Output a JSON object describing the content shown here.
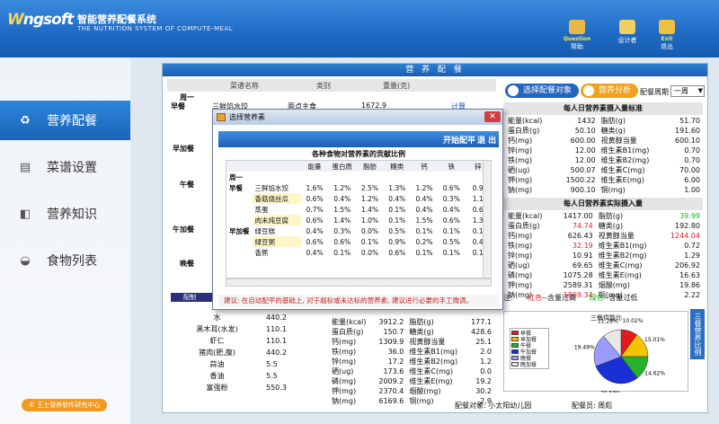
{
  "header": {
    "logo": "ngsoft",
    "title": "智能营养配餐系统",
    "subtitle": "THE NUTRITION SYSTEM OF COMPUTE-MEAL",
    "buttons": [
      {
        "name": "help-button",
        "cap": "Question",
        "label": "帮助"
      },
      {
        "name": "designer-button",
        "cap": "",
        "label": "设计者"
      },
      {
        "name": "exit-button",
        "cap": "Exit",
        "label": "退出"
      }
    ]
  },
  "nav": {
    "items": [
      {
        "label": "营养配餐",
        "icon": "recycle-icon"
      },
      {
        "label": "菜谱设置",
        "icon": "book-icon"
      },
      {
        "label": "营养知识",
        "icon": "knowledge-icon"
      },
      {
        "label": "食物列表",
        "icon": "pot-icon"
      }
    ],
    "footer": "© 王士营养软件研究中心"
  },
  "panel": {
    "title": "营 养 配 餐",
    "grid_headers": [
      "菜谱名称",
      "类别",
      "重量(克)"
    ],
    "day": "周一",
    "meals": [
      "早餐",
      "早加餐",
      "午餐",
      "午加餐",
      "晚餐"
    ],
    "first_row": {
      "name": "三鲜馅水饺",
      "cat": "面点主食",
      "weight": "1672.9",
      "action": "计算"
    },
    "select_btn": "选择配餐对象",
    "analysis_btn": "营养分析",
    "cycle_label": "配餐周期",
    "cycle_value": "一周"
  },
  "std": {
    "title": "每人日营养素摄入量标准",
    "rows": [
      [
        "能量(kcal)",
        "1432",
        "脂肪(g)",
        "51.70"
      ],
      [
        "蛋白质(g)",
        "50.10",
        "糖类(g)",
        "191.60"
      ],
      [
        "钙(mg)",
        "600.00",
        "视黄醇当量",
        "600.10"
      ],
      [
        "锌(mg)",
        "12.00",
        "维生素B1(mg)",
        "0.70"
      ],
      [
        "铁(mg)",
        "12.00",
        "维生素B2(mg)",
        "0.70"
      ],
      [
        "硒(ug)",
        "500.07",
        "维生素C(mg)",
        "70.00"
      ],
      [
        "钾(mg)",
        "1500.22",
        "维生素E(mg)",
        "6.00"
      ],
      [
        "钠(mg)",
        "900.10",
        "铜(mg)",
        "1.00"
      ]
    ]
  },
  "actual": {
    "title": "每人日营养素实际摄入量",
    "rows": [
      [
        "能量(kcal)",
        "1417.00",
        "",
        "脂肪(g)",
        "39.99",
        "green"
      ],
      [
        "蛋白质(g)",
        "74.74",
        "red",
        "糖类(g)",
        "192.80",
        ""
      ],
      [
        "钙(mg)",
        "626.43",
        "",
        "视黄醇当量",
        "1244.04",
        "red"
      ],
      [
        "铁(mg)",
        "32.19",
        "red",
        "维生素B1(mg)",
        "0.72",
        ""
      ],
      [
        "锌(mg)",
        "10.91",
        "",
        "维生素B2(mg)",
        "1.29",
        ""
      ],
      [
        "硒(ug)",
        "69.65",
        "",
        "维生素C(mg)",
        "206.92",
        ""
      ],
      [
        "磷(mg)",
        "1075.28",
        "",
        "维生素E(mg)",
        "16.63",
        ""
      ],
      [
        "钾(mg)",
        "2589.31",
        "",
        "烟酸(mg)",
        "19.86",
        ""
      ],
      [
        "钠(mg)",
        "1869.34",
        "red",
        "铜(mg)",
        "2.22",
        ""
      ]
    ]
  },
  "legend": {
    "note": "注:",
    "red": "红色",
    "red_text": "--含量过高",
    "green": "绿色",
    "green_text": "--含量过低"
  },
  "lower_left": {
    "title": "配制",
    "rows": [
      [
        "水",
        "440.2"
      ],
      [
        "黑木耳(水发)",
        "110.1"
      ],
      [
        "虾仁",
        "110.1"
      ],
      [
        "猪肉(肥,腹)",
        "440.2"
      ],
      [
        "蒜油",
        "5.5"
      ],
      [
        "香油",
        "5.5"
      ],
      [
        "富强粉",
        "550.3"
      ]
    ]
  },
  "lower_mid": {
    "rows": [
      [
        "能量(kcal)",
        "3912.2",
        "脂肪(g)",
        "177.1"
      ],
      [
        "蛋白质(g)",
        "150.7",
        "糖类(g)",
        "428.6"
      ],
      [
        "钙(mg)",
        "1309.9",
        "视黄醇当量",
        "25.1"
      ],
      [
        "铁(mg)",
        "36.0",
        "维生素B1(mg)",
        "2.0"
      ],
      [
        "锌(mg)",
        "17.2",
        "维生素B2(mg)",
        "1.2"
      ],
      [
        "硒(ug)",
        "173.6",
        "维生素C(mg)",
        "0.0"
      ],
      [
        "磷(mg)",
        "2009.2",
        "维生素E(mg)",
        "19.2"
      ],
      [
        "钾(mg)",
        "2370.4",
        "烟酸(mg)",
        "30.2"
      ],
      [
        "钠(mg)",
        "6169.6",
        "铜(mg)",
        "2.9"
      ]
    ]
  },
  "status": {
    "target_label": "配餐对象:",
    "target": "小太阳幼儿园",
    "user_label": "配餐员:",
    "user": "周彪"
  },
  "sidetab": "三餐营养比例",
  "dialog": {
    "title": "选择营养素",
    "auto_btn": "开始配平",
    "exit_btn": "退 出",
    "table_title": "各种食物对营养素的贡献比例",
    "cols": [
      "能量",
      "蛋白质",
      "脂肪",
      "糖类",
      "钙",
      "铁",
      "锌"
    ],
    "day": "周一",
    "rows": [
      {
        "meal": "早餐",
        "food": "三鲜馅水饺",
        "v": [
          "1.6%",
          "1.2%",
          "2.5%",
          "1.3%",
          "1.2%",
          "0.6%",
          "0.9"
        ]
      },
      {
        "meal": "",
        "food": "香菇烧丝瓜",
        "v": [
          "0.6%",
          "0.4%",
          "1.2%",
          "0.4%",
          "0.4%",
          "0.3%",
          "1.1"
        ]
      },
      {
        "meal": "",
        "food": "蒸蛋",
        "v": [
          "0.7%",
          "1.5%",
          "1.4%",
          "0.1%",
          "0.4%",
          "0.4%",
          "0.6"
        ]
      },
      {
        "meal": "",
        "food": "肉末炖豆腐",
        "v": [
          "0.6%",
          "1.4%",
          "1.0%",
          "0.1%",
          "1.5%",
          "0.6%",
          "1.3"
        ]
      },
      {
        "meal": "早加餐",
        "food": "绿豆糕",
        "v": [
          "0.4%",
          "0.3%",
          "0.0%",
          "0.5%",
          "0.1%",
          "0.1%",
          "0.1"
        ]
      },
      {
        "meal": "",
        "food": "绿豆粥",
        "v": [
          "0.6%",
          "0.6%",
          "0.1%",
          "0.9%",
          "0.2%",
          "0.5%",
          "0.4"
        ]
      },
      {
        "meal": "",
        "food": "香蕉",
        "v": [
          "0.4%",
          "0.1%",
          "0.0%",
          "0.6%",
          "0.1%",
          "0.1%",
          "0.1"
        ]
      }
    ],
    "note": "建议: 在自动配平的基础上, 对于超标或未达标的营养素, 建议进行必要的手工微调。"
  },
  "chart_data": {
    "type": "pie",
    "title": "三餐供能比",
    "categories": [
      "早餐",
      "早加餐",
      "午餐",
      "午加餐",
      "晚餐",
      "晚加餐"
    ],
    "values": [
      10.02,
      15.01,
      14.62,
      29.58,
      19.49,
      11.28
    ],
    "colors": [
      "#e11b1b",
      "#f5c400",
      "#27b02b",
      "#1b2fd6",
      "#9a9aff",
      "#e8e8e8"
    ]
  }
}
